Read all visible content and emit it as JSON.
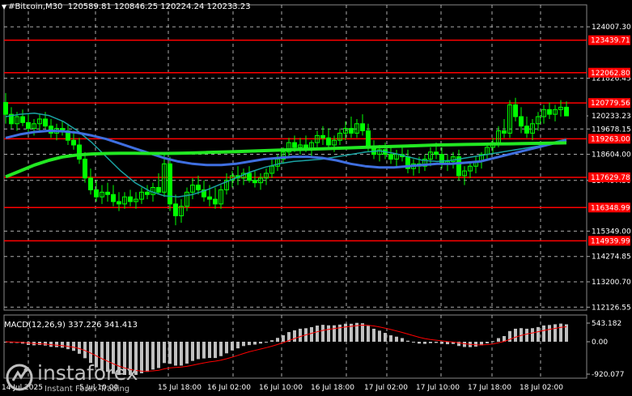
{
  "header": {
    "symbol": "#Bitcoin,M30",
    "ohlc": "120589.81 120846.25 120224.24 120233.23"
  },
  "macd": {
    "label": "MACD(12,26,9) 337.226 341.413",
    "ticks": [
      "543.182",
      "0.00",
      "-920.077"
    ]
  },
  "logo": {
    "brand": "instaforex",
    "tagline": "Instant Forex Trading"
  },
  "colors": {
    "background": "#000000",
    "grid": "#c8c8c8",
    "level": "#ff0000",
    "candle": "#00ff00",
    "ma_fast": "#1aa3a3",
    "ma_mid": "#3f6fe0",
    "ma_slow": "#22e822",
    "macd_hist": "#c0c0c0",
    "macd_signal": "#ff0000",
    "axis_text": "#ffffff"
  },
  "chart_data": {
    "type": "candlestick",
    "symbol": "#Bitcoin",
    "timeframe": "M30",
    "ylim": [
      112000,
      124800
    ],
    "y_ticks": [
      "124007.30",
      "121826.45",
      "120233.23",
      "119678.15",
      "118604.00",
      "117497.30",
      "115349.00",
      "114274.85",
      "113200.70",
      "112126.55"
    ],
    "x_ticks": [
      "14 Jul 2025",
      "15 Jul 18:00",
      "16 Jul 02:00",
      "16 Jul 10:00",
      "16 Jul 18:00",
      "17 Jul 02:00",
      "17 Jul 10:00",
      "17 Jul 18:00",
      "18 Jul 02:00"
    ],
    "x_ticks_partial": [
      "5 Jul 10:00"
    ],
    "current_price": "120233.23",
    "levels": [
      "123439.71",
      "122062.80",
      "120779.56",
      "119263.00",
      "117629.78",
      "116348.99",
      "114939.99"
    ],
    "candles": [
      [
        120800,
        121200,
        119900,
        120300
      ],
      [
        120300,
        120600,
        119700,
        119900
      ],
      [
        119900,
        120400,
        119600,
        120200
      ],
      [
        120200,
        120500,
        119800,
        119950
      ],
      [
        119950,
        120300,
        119500,
        119700
      ],
      [
        119700,
        120100,
        119400,
        119900
      ],
      [
        119900,
        120300,
        119600,
        120100
      ],
      [
        120100,
        120400,
        119700,
        119800
      ],
      [
        119800,
        120100,
        119300,
        119500
      ],
      [
        119500,
        119900,
        119200,
        119700
      ],
      [
        119700,
        120000,
        119400,
        119600
      ],
      [
        119600,
        119900,
        119000,
        119200
      ],
      [
        119200,
        119600,
        118800,
        119000
      ],
      [
        119000,
        119300,
        118200,
        118400
      ],
      [
        118400,
        118700,
        117400,
        117600
      ],
      [
        117600,
        118000,
        116900,
        117100
      ],
      [
        117100,
        117500,
        116600,
        116800
      ],
      [
        116800,
        117300,
        116500,
        117000
      ],
      [
        117000,
        117400,
        116600,
        116900
      ],
      [
        116900,
        117300,
        116400,
        116600
      ],
      [
        116600,
        117000,
        116200,
        116500
      ],
      [
        116500,
        117000,
        116300,
        116800
      ],
      [
        116800,
        117100,
        116400,
        116600
      ],
      [
        116600,
        117000,
        116300,
        116700
      ],
      [
        116700,
        117200,
        116500,
        117000
      ],
      [
        117000,
        117300,
        116700,
        116900
      ],
      [
        116900,
        117400,
        116600,
        117200
      ],
      [
        117200,
        117800,
        116900,
        117000
      ],
      [
        117000,
        118600,
        116800,
        118200
      ],
      [
        118200,
        118500,
        116200,
        116500
      ],
      [
        116500,
        116900,
        115600,
        116000
      ],
      [
        116000,
        116700,
        115700,
        116400
      ],
      [
        116400,
        117200,
        116200,
        117000
      ],
      [
        117000,
        117600,
        116700,
        117300
      ],
      [
        117300,
        117700,
        116900,
        117100
      ],
      [
        117100,
        117500,
        116600,
        116800
      ],
      [
        116800,
        117300,
        116400,
        116700
      ],
      [
        116700,
        117200,
        116300,
        116500
      ],
      [
        116500,
        117300,
        116300,
        117100
      ],
      [
        117100,
        117800,
        116900,
        117500
      ],
      [
        117500,
        117900,
        117200,
        117700
      ],
      [
        117700,
        118100,
        117300,
        117600
      ],
      [
        117600,
        118000,
        117300,
        117800
      ],
      [
        117800,
        118100,
        117400,
        117500
      ],
      [
        117500,
        117900,
        117200,
        117400
      ],
      [
        117400,
        117800,
        117100,
        117600
      ],
      [
        117600,
        118000,
        117300,
        117800
      ],
      [
        117800,
        118400,
        117600,
        118100
      ],
      [
        118100,
        118600,
        117900,
        118400
      ],
      [
        118400,
        118900,
        118200,
        118700
      ],
      [
        118700,
        119300,
        118500,
        119100
      ],
      [
        119100,
        119400,
        118700,
        118900
      ],
      [
        118900,
        119300,
        118600,
        119000
      ],
      [
        119000,
        119400,
        118700,
        118800
      ],
      [
        118800,
        119200,
        118500,
        119100
      ],
      [
        119100,
        119600,
        118900,
        119400
      ],
      [
        119400,
        119800,
        119000,
        119300
      ],
      [
        119300,
        119700,
        118900,
        119000
      ],
      [
        119000,
        119400,
        118700,
        119200
      ],
      [
        119200,
        119700,
        119000,
        119500
      ],
      [
        119500,
        120000,
        119200,
        119700
      ],
      [
        119700,
        120200,
        119300,
        119500
      ],
      [
        119500,
        120100,
        119300,
        119900
      ],
      [
        119900,
        120300,
        119400,
        119600
      ],
      [
        119600,
        119900,
        118700,
        118900
      ],
      [
        118900,
        119200,
        118400,
        118600
      ],
      [
        118600,
        119000,
        118300,
        118800
      ],
      [
        118800,
        119100,
        118400,
        118600
      ],
      [
        118600,
        118900,
        118200,
        118400
      ],
      [
        118400,
        118800,
        118100,
        118600
      ],
      [
        118600,
        118900,
        118300,
        118500
      ],
      [
        118500,
        118800,
        117800,
        118000
      ],
      [
        118000,
        118400,
        117700,
        118200
      ],
      [
        118200,
        118500,
        117800,
        118100
      ],
      [
        118100,
        118600,
        117900,
        118400
      ],
      [
        118400,
        118900,
        118100,
        118700
      ],
      [
        118700,
        119100,
        118400,
        118600
      ],
      [
        118600,
        118900,
        118000,
        118200
      ],
      [
        118200,
        118600,
        117900,
        118300
      ],
      [
        118300,
        118700,
        118000,
        118500
      ],
      [
        118500,
        118800,
        117500,
        117700
      ],
      [
        117700,
        118100,
        117300,
        117900
      ],
      [
        117900,
        118300,
        117600,
        118100
      ],
      [
        118100,
        118500,
        117800,
        118300
      ],
      [
        118300,
        118700,
        118000,
        118600
      ],
      [
        118600,
        119100,
        118400,
        118900
      ],
      [
        118900,
        119300,
        118600,
        119100
      ],
      [
        119100,
        119800,
        118900,
        119600
      ],
      [
        119600,
        120100,
        119300,
        119500
      ],
      [
        119500,
        120900,
        119300,
        120700
      ],
      [
        120700,
        121000,
        120000,
        120200
      ],
      [
        120200,
        120600,
        119500,
        119800
      ],
      [
        119800,
        120200,
        119300,
        119500
      ],
      [
        119500,
        120100,
        119200,
        119900
      ],
      [
        119900,
        120400,
        119600,
        120200
      ],
      [
        120200,
        120700,
        119900,
        120500
      ],
      [
        120500,
        120800,
        120100,
        120300
      ],
      [
        120300,
        120700,
        120000,
        120500
      ],
      [
        120500,
        120900,
        120200,
        120600
      ],
      [
        120600,
        120846,
        120224,
        120233
      ]
    ],
    "moving_averages": [
      {
        "color": "#1aa3a3",
        "values": [
          120200,
          120300,
          120350,
          120250,
          120000,
          119600,
          119100,
          118500,
          117900,
          117400,
          117050,
          116850,
          116800,
          116900,
          117100,
          117350,
          117600,
          117850,
          118050,
          118200,
          118300,
          118350,
          118400,
          118500,
          118600,
          118700,
          118750,
          118650,
          118500,
          118350,
          118300,
          118350,
          118450,
          118550,
          118650,
          118750,
          118850,
          118950,
          119100,
          119250
        ]
      },
      {
        "color": "#3f6fe0",
        "values": [
          119300,
          119450,
          119550,
          119600,
          119580,
          119520,
          119400,
          119250,
          119050,
          118850,
          118650,
          118450,
          118300,
          118200,
          118150,
          118150,
          118200,
          118300,
          118400,
          118450,
          118500,
          118500,
          118450,
          118350,
          118200,
          118100,
          118050,
          118050,
          118100,
          118150,
          118200,
          118200,
          118250,
          118300,
          118450,
          118600,
          118750,
          118900,
          119050,
          119200
        ]
      },
      {
        "color": "#22e822",
        "values": [
          117650,
          117900,
          118150,
          118350,
          118500,
          118580,
          118620,
          118640,
          118650,
          118650,
          118640,
          118640,
          118650,
          118660,
          118680,
          118700,
          118720,
          118740,
          118760,
          118780,
          118800,
          118820,
          118840,
          118860,
          118880,
          118900,
          118920,
          118940,
          118960,
          118980,
          119000,
          119010,
          119020,
          119030,
          119040,
          119050,
          119060,
          119070,
          119080,
          119090
        ]
      }
    ]
  }
}
